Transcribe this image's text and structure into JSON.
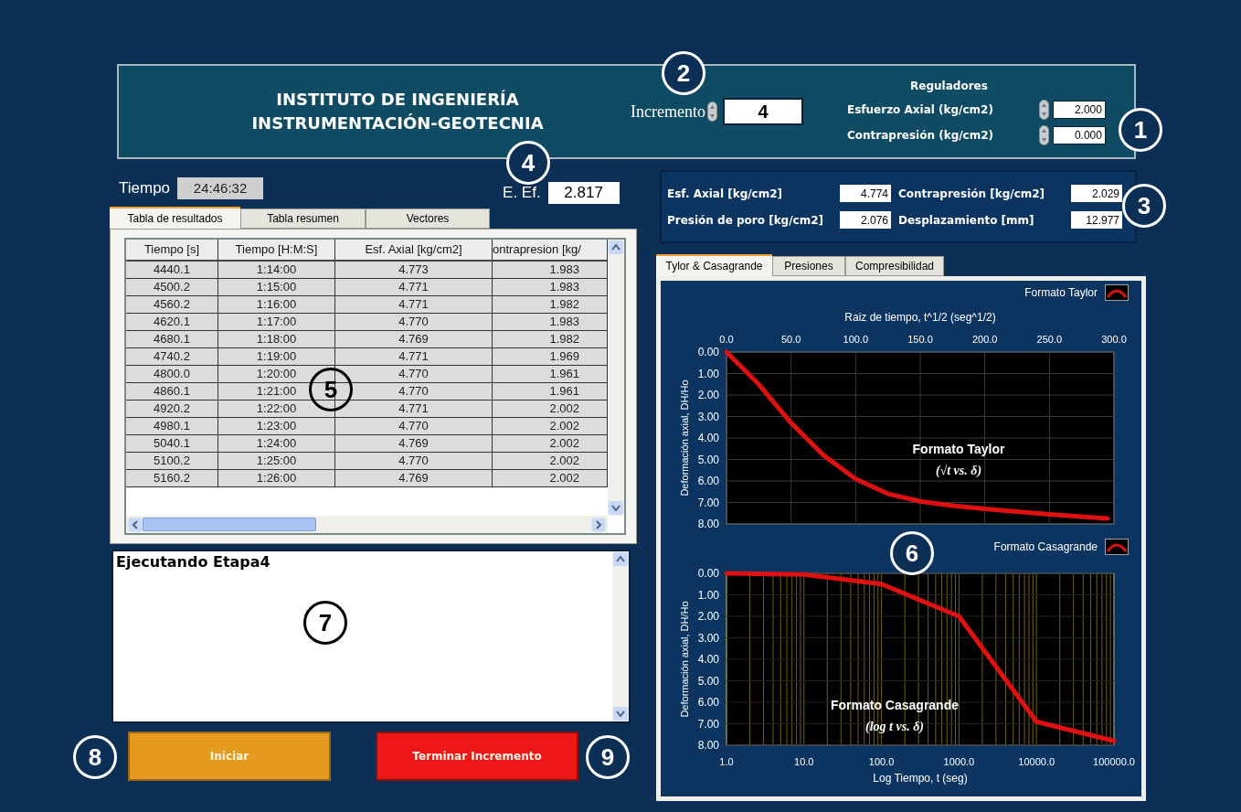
{
  "header": {
    "title_lines": [
      "INSTITUTO DE INGENIERÍA",
      "INSTRUMENTACIÓN-GEOTECNIA"
    ],
    "increment": {
      "label": "Incremento",
      "value": "4"
    },
    "regulators": {
      "title": "Reguladores",
      "items": [
        {
          "label": "Esfuerzo Axial (kg/cm2)",
          "value": "2.000"
        },
        {
          "label": "Contrapresión (kg/cm2)",
          "value": "0.000"
        }
      ]
    }
  },
  "time": {
    "label": "Tiempo",
    "value": "24:46:32"
  },
  "effective_stress": {
    "label": "E. Ef.",
    "value": "2.817"
  },
  "left_tabs": [
    {
      "label": "Tabla de resultados",
      "selected": true
    },
    {
      "label": "Tabla resumen",
      "selected": false
    },
    {
      "label": "Vectores",
      "selected": false
    }
  ],
  "table": {
    "columns": [
      "Tiempo [s]",
      "Tiempo [H:M:S]",
      "Esf. Axial [kg/cm2]",
      "ontrapresion  [kg/"
    ],
    "rows": [
      [
        "4440.1",
        "1:14:00",
        "4.773",
        "1.983"
      ],
      [
        "4500.2",
        "1:15:00",
        "4.771",
        "1.983"
      ],
      [
        "4560.2",
        "1:16:00",
        "4.771",
        "1.982"
      ],
      [
        "4620.1",
        "1:17:00",
        "4.770",
        "1.983"
      ],
      [
        "4680.1",
        "1:18:00",
        "4.769",
        "1.982"
      ],
      [
        "4740.2",
        "1:19:00",
        "4.771",
        "1.969"
      ],
      [
        "4800.0",
        "1:20:00",
        "4.770",
        "1.961"
      ],
      [
        "4860.1",
        "1:21:00",
        "4.770",
        "1.961"
      ],
      [
        "4920.2",
        "1:22:00",
        "4.771",
        "2.002"
      ],
      [
        "4980.1",
        "1:23:00",
        "4.770",
        "2.002"
      ],
      [
        "5040.1",
        "1:24:00",
        "4.769",
        "2.002"
      ],
      [
        "5100.2",
        "1:25:00",
        "4.770",
        "2.002"
      ],
      [
        "5160.2",
        "1:26:00",
        "4.769",
        "2.002"
      ]
    ]
  },
  "log": {
    "text": "Ejecutando Etapa4"
  },
  "buttons": [
    {
      "label": "Iniciar",
      "kind": "start"
    },
    {
      "label": "Terminar Incremento",
      "kind": "stop"
    }
  ],
  "readings": [
    {
      "label": "Esf. Axial [kg/cm2]",
      "value": "4.774"
    },
    {
      "label": "Contrapresión [kg/cm2]",
      "value": "2.029"
    },
    {
      "label": "Presión de poro [kg/cm2]",
      "value": "2.076"
    },
    {
      "label": "Desplazamiento [mm]",
      "value": "12.977"
    }
  ],
  "right_tabs": [
    {
      "label": "Tylor & Casagrande",
      "selected": true
    },
    {
      "label": "Presiones",
      "selected": false
    },
    {
      "label": "Compresibilidad",
      "selected": false
    }
  ],
  "charts": [
    {
      "chart_data": {
        "type": "line",
        "xlabel": "Raiz de tiempo, t^1/2 (seg^1/2)",
        "ylabel": "Deformación axial, DH/Ho",
        "x": [
          0,
          25,
          50,
          75,
          100,
          125,
          150,
          175,
          200,
          250,
          295
        ],
        "series": [
          {
            "name": "Formato Taylor",
            "color": "#e01010",
            "values": [
              0,
              1.5,
              3.3,
              4.8,
              5.9,
              6.6,
              6.95,
              7.15,
              7.3,
              7.55,
              7.75
            ]
          }
        ],
        "xlim": [
          0,
          300
        ],
        "ylim": [
          8,
          0
        ],
        "grid": true,
        "xticks": [
          {
            "value": 0,
            "label": "0.0"
          },
          {
            "value": 50,
            "label": "50.0"
          },
          {
            "value": 100,
            "label": "100.0"
          },
          {
            "value": 150,
            "label": "150.0"
          },
          {
            "value": 200,
            "label": "200.0"
          },
          {
            "value": 250,
            "label": "250.0"
          },
          {
            "value": 300,
            "label": "300.0"
          }
        ],
        "yticks": [
          {
            "value": 0,
            "label": "0.00"
          },
          {
            "value": 1,
            "label": "1.00"
          },
          {
            "value": 2,
            "label": "2.00"
          },
          {
            "value": 3,
            "label": "3.00"
          },
          {
            "value": 4,
            "label": "4.00"
          },
          {
            "value": 5,
            "label": "5.00"
          },
          {
            "value": 6,
            "label": "6.00"
          },
          {
            "value": 7,
            "label": "7.00"
          },
          {
            "value": 8,
            "label": "8.00"
          }
        ],
        "annotations": [
          {
            "text": "Formato Taylor"
          },
          {
            "text": "(√t vs. δ)"
          }
        ]
      }
    },
    {
      "chart_data": {
        "type": "line",
        "xlabel": "Log Tiempo, t (seg)",
        "ylabel": "Deformación axial, DH/Ho",
        "categories": [
          "1.0",
          "10.0",
          "100.0",
          "1000.0",
          "10000.0",
          "100000.0"
        ],
        "series": [
          {
            "name": "Formato Casagrande",
            "color": "#e01010",
            "values": [
              0,
              0.05,
              0.5,
              2.0,
              6.9,
              7.8
            ]
          }
        ],
        "ylim": [
          8,
          0
        ],
        "grid": true,
        "yticks": [
          {
            "value": 0,
            "label": "0.00"
          },
          {
            "value": 1,
            "label": "1.00"
          },
          {
            "value": 2,
            "label": "2.00"
          },
          {
            "value": 3,
            "label": "3.00"
          },
          {
            "value": 4,
            "label": "4.00"
          },
          {
            "value": 5,
            "label": "5.00"
          },
          {
            "value": 6,
            "label": "6.00"
          },
          {
            "value": 7,
            "label": "7.00"
          },
          {
            "value": 8,
            "label": "8.00"
          }
        ],
        "annotations": [
          {
            "text": "Formato Casagrande"
          },
          {
            "text": "(log t  vs. δ)"
          }
        ]
      }
    }
  ],
  "callouts": [
    {
      "label": "1",
      "kind": "light"
    },
    {
      "label": "2",
      "kind": "light"
    },
    {
      "label": "3",
      "kind": "light"
    },
    {
      "label": "4",
      "kind": "light"
    },
    {
      "label": "5",
      "kind": "dark"
    },
    {
      "label": "6",
      "kind": "light"
    },
    {
      "label": "7",
      "kind": "dark"
    },
    {
      "label": "8",
      "kind": "light"
    },
    {
      "label": "9",
      "kind": "light"
    }
  ]
}
